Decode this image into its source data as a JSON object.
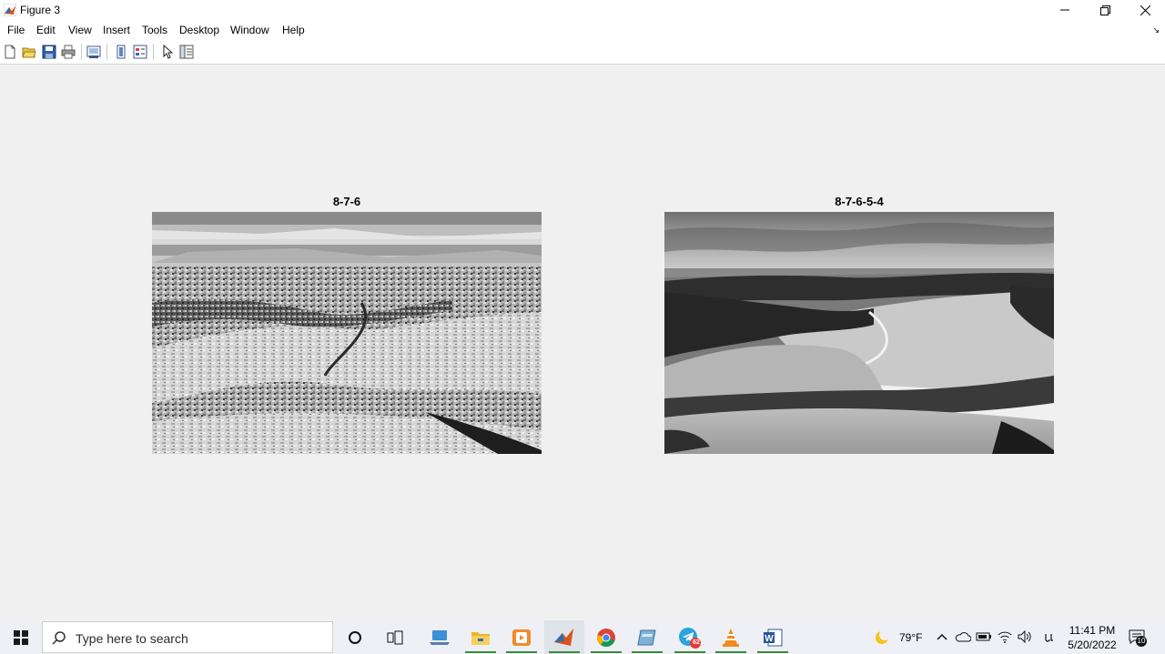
{
  "window": {
    "title": "Figure 3"
  },
  "menu": [
    "File",
    "Edit",
    "View",
    "Insert",
    "Tools",
    "Desktop",
    "Window",
    "Help"
  ],
  "toolbar_icons": [
    "new-figure-icon",
    "open-icon",
    "save-icon",
    "print-icon",
    "link-plot-icon",
    "colorbar-icon",
    "legend-icon",
    "pointer-icon",
    "property-inspector-icon"
  ],
  "axes": [
    {
      "title": "8-7-6"
    },
    {
      "title": "8-7-6-5-4"
    }
  ],
  "taskbar": {
    "search_placeholder": "Type here to search",
    "telegram_badge": "62",
    "weather": "79°F",
    "time": "11:41 PM",
    "date": "5/20/2022",
    "notification_count": "10"
  }
}
